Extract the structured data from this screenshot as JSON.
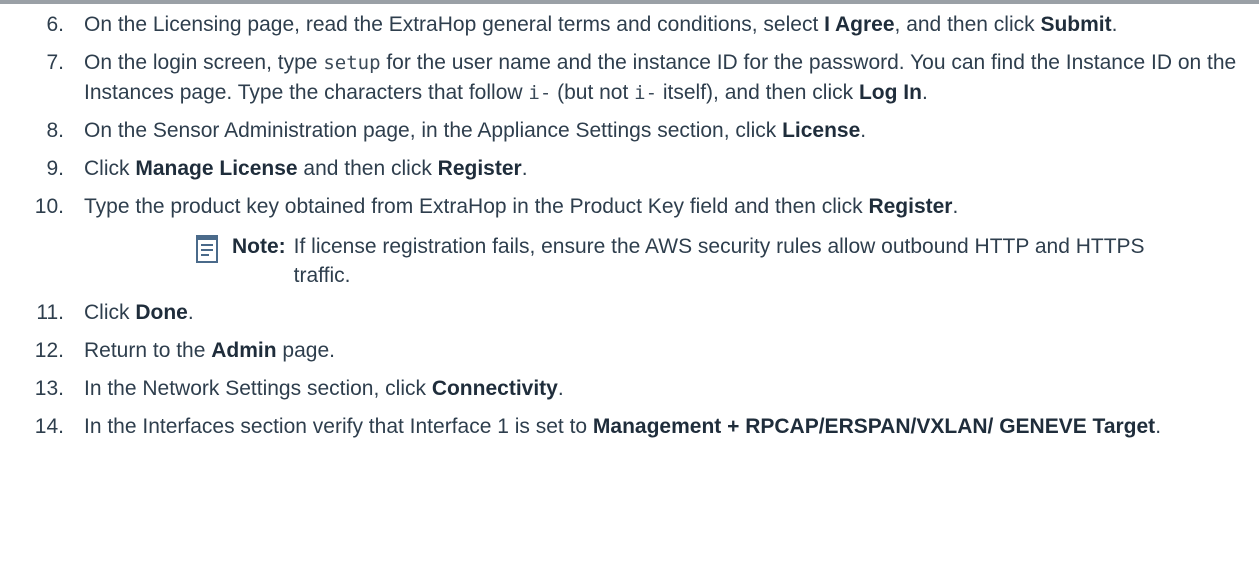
{
  "steps": [
    {
      "num": "6.",
      "parts": [
        {
          "t": "text",
          "v": "On the Licensing page, read the ExtraHop general terms and conditions, select "
        },
        {
          "t": "bold",
          "v": "I Agree"
        },
        {
          "t": "text",
          "v": ", and then click "
        },
        {
          "t": "bold",
          "v": "Submit"
        },
        {
          "t": "text",
          "v": "."
        }
      ]
    },
    {
      "num": "7.",
      "parts": [
        {
          "t": "text",
          "v": "On the login screen, type "
        },
        {
          "t": "code",
          "v": "setup"
        },
        {
          "t": "text",
          "v": " for the user name and the instance ID for the password. You can find the Instance ID on the Instances page. Type the characters that follow "
        },
        {
          "t": "code",
          "v": "i-"
        },
        {
          "t": "text",
          "v": " (but not "
        },
        {
          "t": "code",
          "v": "i-"
        },
        {
          "t": "text",
          "v": " itself), and then click "
        },
        {
          "t": "bold",
          "v": "Log In"
        },
        {
          "t": "text",
          "v": "."
        }
      ]
    },
    {
      "num": "8.",
      "parts": [
        {
          "t": "text",
          "v": "On the Sensor Administration page, in the Appliance Settings section, click "
        },
        {
          "t": "bold",
          "v": "License"
        },
        {
          "t": "text",
          "v": "."
        }
      ]
    },
    {
      "num": "9.",
      "parts": [
        {
          "t": "text",
          "v": "Click "
        },
        {
          "t": "bold",
          "v": "Manage License"
        },
        {
          "t": "text",
          "v": " and then click "
        },
        {
          "t": "bold",
          "v": "Register"
        },
        {
          "t": "text",
          "v": "."
        }
      ]
    },
    {
      "num": "10.",
      "parts": [
        {
          "t": "text",
          "v": "Type the product key obtained from ExtraHop in the Product Key field and then click "
        },
        {
          "t": "bold",
          "v": "Register"
        },
        {
          "t": "text",
          "v": "."
        }
      ],
      "note": {
        "label": "Note:",
        "text": "If license registration fails, ensure the AWS security rules allow outbound HTTP and HTTPS traffic."
      }
    },
    {
      "num": "11.",
      "parts": [
        {
          "t": "text",
          "v": "Click "
        },
        {
          "t": "bold",
          "v": "Done"
        },
        {
          "t": "text",
          "v": "."
        }
      ]
    },
    {
      "num": "12.",
      "parts": [
        {
          "t": "text",
          "v": "Return to the "
        },
        {
          "t": "bold",
          "v": "Admin"
        },
        {
          "t": "text",
          "v": " page."
        }
      ]
    },
    {
      "num": "13.",
      "parts": [
        {
          "t": "text",
          "v": "In the Network Settings section, click "
        },
        {
          "t": "bold",
          "v": "Connectivity"
        },
        {
          "t": "text",
          "v": "."
        }
      ]
    },
    {
      "num": "14.",
      "parts": [
        {
          "t": "text",
          "v": "In the Interfaces section verify that Interface 1 is set to "
        },
        {
          "t": "bold",
          "v": "Management + RPCAP/ERSPAN/VXLAN/ GENEVE Target"
        },
        {
          "t": "text",
          "v": "."
        }
      ]
    }
  ],
  "colors": {
    "text": "#2e3e4d",
    "note_icon": "#4a6a8a",
    "rule": "#9aa0a6"
  },
  "icons": {
    "note": "note-document-icon"
  }
}
